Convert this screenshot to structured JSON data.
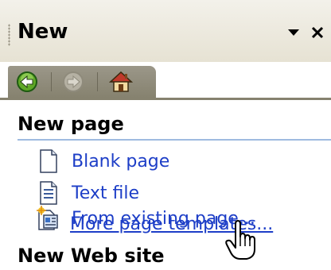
{
  "taskpane": {
    "title": "New",
    "menu_icon": "dropdown-arrow-icon",
    "close_label": "×"
  },
  "nav": {
    "back_icon": "back-arrow-icon",
    "forward_icon": "forward-arrow-icon",
    "home_icon": "home-icon"
  },
  "sections": {
    "new_page": {
      "header": "New page",
      "items": [
        {
          "label": "Blank page",
          "icon": "blank-page-icon"
        },
        {
          "label": "Text file",
          "icon": "text-file-icon"
        },
        {
          "label": "From existing page...",
          "icon": "existing-page-icon"
        }
      ],
      "more_link": "More page templates..."
    },
    "new_web_site": {
      "header": "New Web site"
    }
  },
  "colors": {
    "link": "#1d3ec7",
    "section_rule": "#9fbbe0",
    "navbar": "#86826f"
  }
}
